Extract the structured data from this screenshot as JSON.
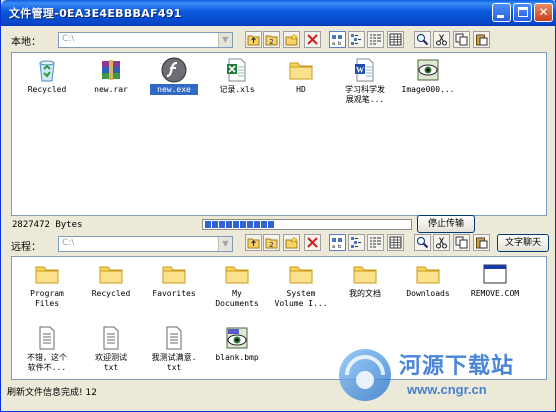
{
  "window": {
    "title": "文件管理-0EA3E4EBBBAF491"
  },
  "local": {
    "label": "本地：",
    "path_value": "C:\\",
    "files": [
      {
        "name": "Recycled",
        "icon": "recycle-bin-icon",
        "selected": false
      },
      {
        "name": "new.rar",
        "icon": "rar-archive-icon",
        "selected": false
      },
      {
        "name": "new.exe",
        "icon": "flash-exe-icon",
        "selected": true
      },
      {
        "name": "记录.xls",
        "icon": "excel-file-icon",
        "selected": false
      },
      {
        "name": "HD",
        "icon": "folder-icon",
        "selected": false
      },
      {
        "name": "学习科学发\n展观笔...",
        "icon": "word-file-icon",
        "selected": false
      },
      {
        "name": "Image000...",
        "icon": "image-viewer-icon",
        "selected": false
      }
    ]
  },
  "transfer": {
    "bytes_text": "2827472 Bytes",
    "progress_segments_filled": 10,
    "stop_button": "停止传输"
  },
  "remote": {
    "label": "远程：",
    "path_value": "C:\\",
    "chat_button": "文字聊天",
    "files": [
      {
        "name": "Program\nFiles",
        "icon": "folder-icon"
      },
      {
        "name": "Recycled",
        "icon": "folder-icon"
      },
      {
        "name": "Favorites",
        "icon": "folder-icon"
      },
      {
        "name": "My\nDocuments",
        "icon": "folder-icon"
      },
      {
        "name": "System\nVolume I...",
        "icon": "folder-icon"
      },
      {
        "name": "我的文档",
        "icon": "folder-icon"
      },
      {
        "name": "Downloads",
        "icon": "folder-icon"
      },
      {
        "name": "REMOVE.COM",
        "icon": "window-app-icon"
      },
      {
        "name": "不错，这个\n软件不...",
        "icon": "text-file-icon"
      },
      {
        "name": "欢迎测试\ntxt",
        "icon": "text-file-icon"
      },
      {
        "name": "我测试满意.\ntxt",
        "icon": "text-file-icon"
      },
      {
        "name": "blank.bmp",
        "icon": "bmp-image-icon"
      }
    ]
  },
  "status": {
    "text": "刷新文件信息完成! 12"
  },
  "watermark": {
    "title": "河源下载站",
    "url": "www.cngr.cn"
  },
  "colors": {
    "titlebar": "#0a58dc",
    "window_bg": "#ece9d8",
    "selection": "#316ac5",
    "progress": "#2f62d2"
  }
}
